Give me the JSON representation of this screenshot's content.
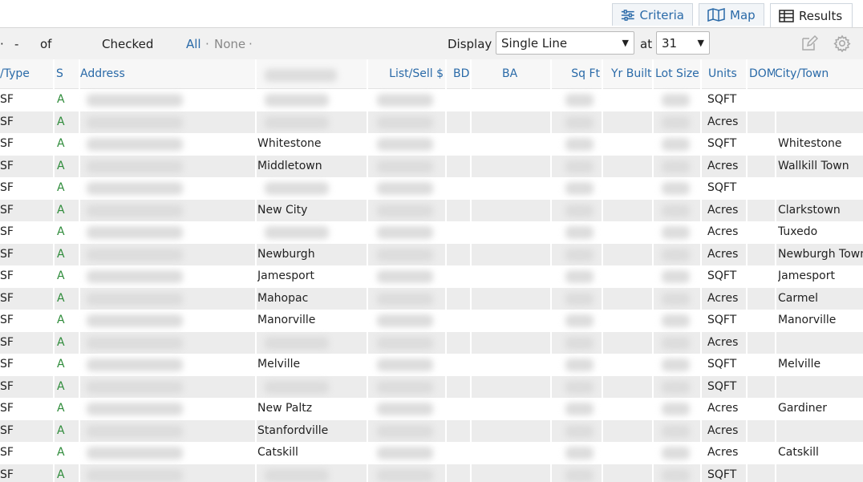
{
  "tabs": {
    "criteria": "Criteria",
    "map": "Map",
    "results": "Results"
  },
  "toolbar": {
    "dot": "·",
    "dash": "-",
    "of": "of",
    "checked": "Checked",
    "all": "All",
    "none": "None",
    "separator": "·",
    "display_label": "Display",
    "display_value": "Single Line",
    "at_label": "at",
    "at_value": "31"
  },
  "columns": [
    "/Type",
    "S",
    "Address",
    "List/Sell $",
    "BD",
    "BA",
    "Sq Ft",
    "Yr Built",
    "Lot Size",
    "Units",
    "DOM",
    "City/Town"
  ],
  "rows": [
    {
      "type": "SF",
      "s": "A",
      "area": "",
      "units": "SQFT",
      "city": ""
    },
    {
      "type": "SF",
      "s": "A",
      "area": "",
      "units": "Acres",
      "city": ""
    },
    {
      "type": "SF",
      "s": "A",
      "area": "Whitestone",
      "units": "SQFT",
      "city": "Whitestone"
    },
    {
      "type": "SF",
      "s": "A",
      "area": "Middletown",
      "units": "Acres",
      "city": "Wallkill Town"
    },
    {
      "type": "SF",
      "s": "A",
      "area": "",
      "units": "SQFT",
      "city": ""
    },
    {
      "type": "SF",
      "s": "A",
      "area": "New City",
      "units": "Acres",
      "city": "Clarkstown"
    },
    {
      "type": "SF",
      "s": "A",
      "area": "",
      "units": "Acres",
      "city": "Tuxedo"
    },
    {
      "type": "SF",
      "s": "A",
      "area": "Newburgh",
      "units": "Acres",
      "city": "Newburgh Town"
    },
    {
      "type": "SF",
      "s": "A",
      "area": "Jamesport",
      "units": "SQFT",
      "city": "Jamesport"
    },
    {
      "type": "SF",
      "s": "A",
      "area": "Mahopac",
      "units": "Acres",
      "city": "Carmel"
    },
    {
      "type": "SF",
      "s": "A",
      "area": "Manorville",
      "units": "SQFT",
      "city": "Manorville"
    },
    {
      "type": "SF",
      "s": "A",
      "area": "",
      "units": "Acres",
      "city": ""
    },
    {
      "type": "SF",
      "s": "A",
      "area": "Melville",
      "units": "SQFT",
      "city": "Melville"
    },
    {
      "type": "SF",
      "s": "A",
      "area": "",
      "units": "SQFT",
      "city": ""
    },
    {
      "type": "SF",
      "s": "A",
      "area": "New Paltz",
      "units": "Acres",
      "city": "Gardiner"
    },
    {
      "type": "SF",
      "s": "A",
      "area": "Stanfordville",
      "units": "Acres",
      "city": ""
    },
    {
      "type": "SF",
      "s": "A",
      "area": "Catskill",
      "units": "Acres",
      "city": "Catskill"
    },
    {
      "type": "SF",
      "s": "A",
      "area": "",
      "units": "SQFT",
      "city": ""
    }
  ],
  "colors": {
    "link": "#2a6aa8",
    "status": "#2e8b3a",
    "row_alt": "#ececec"
  },
  "icons": [
    "criteria-sliders-icon",
    "map-icon",
    "results-grid-icon",
    "edit-icon",
    "gear-icon"
  ]
}
